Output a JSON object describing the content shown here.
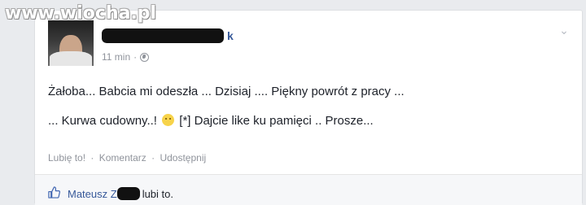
{
  "watermark": "www.wiocha.pl",
  "post": {
    "author_visible_suffix": "k",
    "time": "11 min",
    "time_separator": "·",
    "privacy_icon": "globe-icon",
    "text_line_1": "Żałoba... Babcia mi odeszła ... Dzisiaj .... Piękny powrót z pracy ...",
    "text_line_2_a": "... Kurwa cudowny..!",
    "text_line_2_b": "[*] Dajcie like ku pamięci .. Prosze...",
    "emoji": "frown-emoji"
  },
  "actions": {
    "like": "Lubię to!",
    "comment": "Komentarz",
    "share": "Udostępnij",
    "separator": "·"
  },
  "likes_bar": {
    "name_visible": "Mateusz Z",
    "suffix": "lubi to."
  },
  "colors": {
    "link": "#365899",
    "muted": "#90949c",
    "text": "#1d2129",
    "background": "#e9ebee"
  }
}
